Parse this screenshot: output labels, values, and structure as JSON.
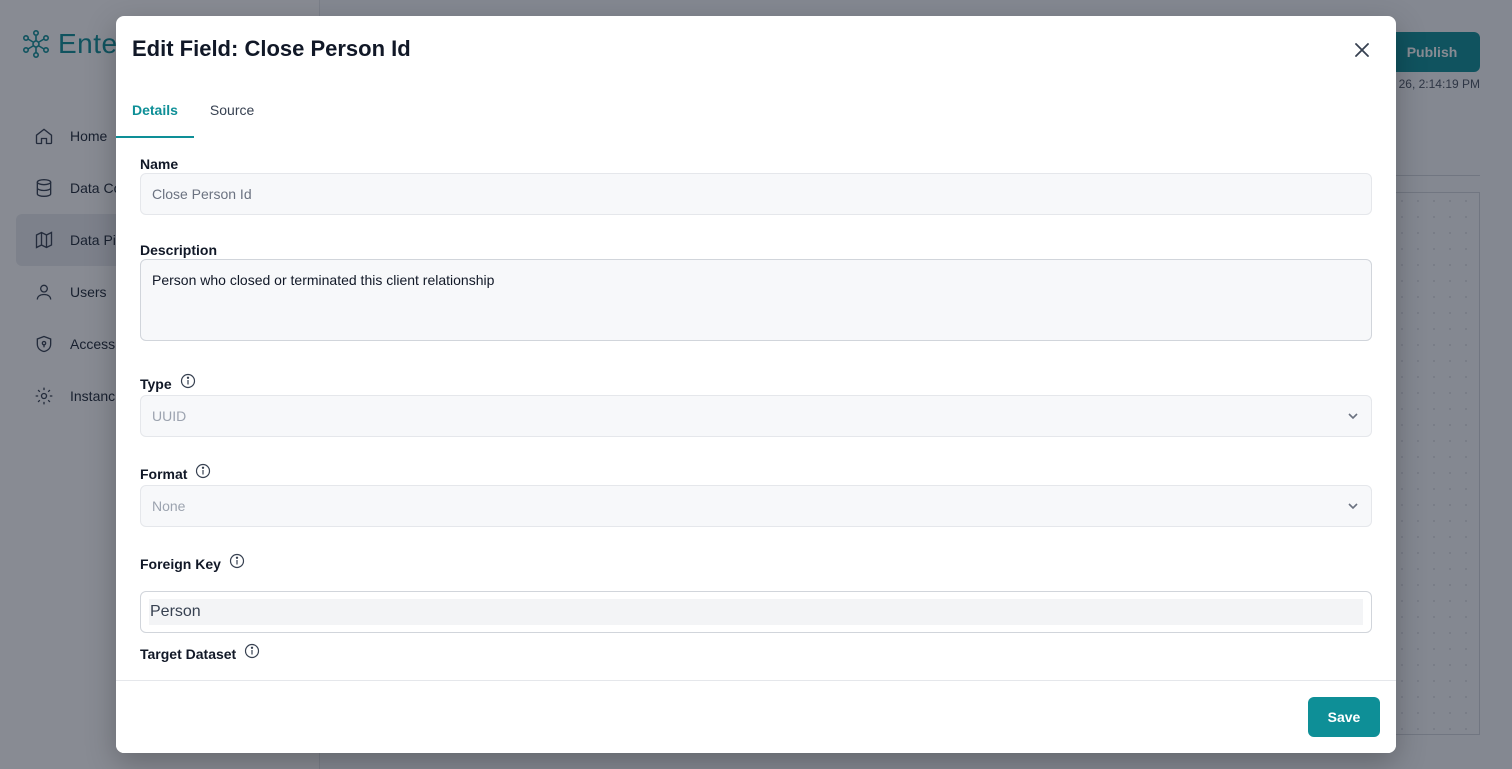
{
  "app": {
    "logo_text": "Enteg",
    "nav": [
      {
        "label": "Home",
        "icon": "home-icon"
      },
      {
        "label": "Data Co",
        "icon": "database-icon"
      },
      {
        "label": "Data Pi",
        "icon": "map-icon",
        "active": true
      },
      {
        "label": "Users",
        "icon": "user-icon"
      },
      {
        "label": "Access",
        "icon": "shield-icon"
      },
      {
        "label": "Instanc",
        "icon": "gear-icon"
      }
    ],
    "publish_label": "Publish",
    "saved_time": "26, 2:14:19 PM"
  },
  "modal": {
    "title": "Edit Field: Close Person Id",
    "tabs": [
      {
        "label": "Details",
        "active": true
      },
      {
        "label": "Source",
        "active": false
      }
    ],
    "fields": {
      "name": {
        "label": "Name",
        "value": "Close Person Id"
      },
      "description": {
        "label": "Description",
        "value": "Person who closed or terminated this client relationship"
      },
      "type": {
        "label": "Type",
        "value": "UUID"
      },
      "format": {
        "label": "Format",
        "value": "None"
      },
      "foreign_key": {
        "label": "Foreign Key",
        "value": "Person"
      },
      "target_dataset": {
        "label": "Target Dataset"
      }
    },
    "save_label": "Save"
  },
  "colors": {
    "accent": "#0e8f97",
    "overlay": "rgba(17,24,39,0.5)"
  }
}
